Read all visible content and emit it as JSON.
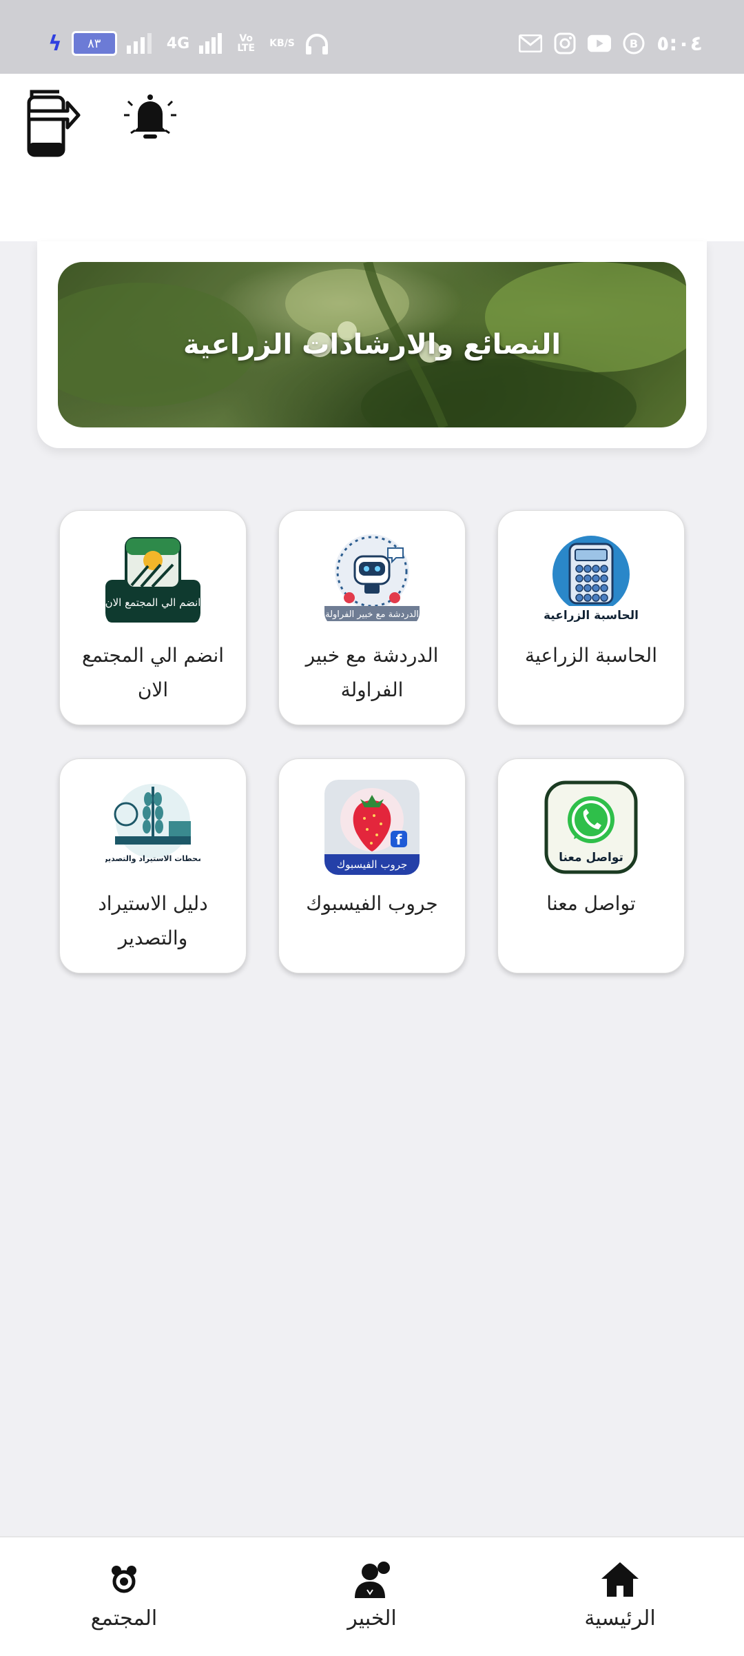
{
  "status_bar": {
    "battery": "٨٣",
    "network_1": "4G",
    "network_2": "Vo LTE",
    "speed_unit": "KB/S",
    "time": "٥:٠٤"
  },
  "header": {
    "share_icon": "phone-share-icon",
    "notify_icon": "bell-icon"
  },
  "banner": {
    "title": "النصائع والارشادات الزراعية"
  },
  "tiles": [
    {
      "label": "الحاسبة الزراعية",
      "icon": "calculator-icon",
      "image_caption": "الحاسبة الزراعية"
    },
    {
      "label": "الدردشة مع خبير الفراولة",
      "icon": "robot-chat-icon",
      "image_caption": "الدردشة مع خبير الفراولة"
    },
    {
      "label": "انضم الي المجتمع الان",
      "icon": "community-join-icon",
      "image_caption": "انضم الي المجتمع الان"
    },
    {
      "label": "تواصل معنا",
      "icon": "whatsapp-icon",
      "image_caption": "تواصل معنا"
    },
    {
      "label": "جروب الفيسبوك",
      "icon": "strawberry-facebook-icon",
      "image_caption": "جروب الفيسبوك"
    },
    {
      "label": "دليل الاستيراد والتصدير",
      "icon": "import-export-icon",
      "image_caption": "محطات الاستيراد والتصدير"
    }
  ],
  "bottom_nav": [
    {
      "label": "الرئيسية",
      "icon": "home-icon"
    },
    {
      "label": "الخبير",
      "icon": "expert-icon"
    },
    {
      "label": "المجتمع",
      "icon": "community-icon"
    }
  ]
}
